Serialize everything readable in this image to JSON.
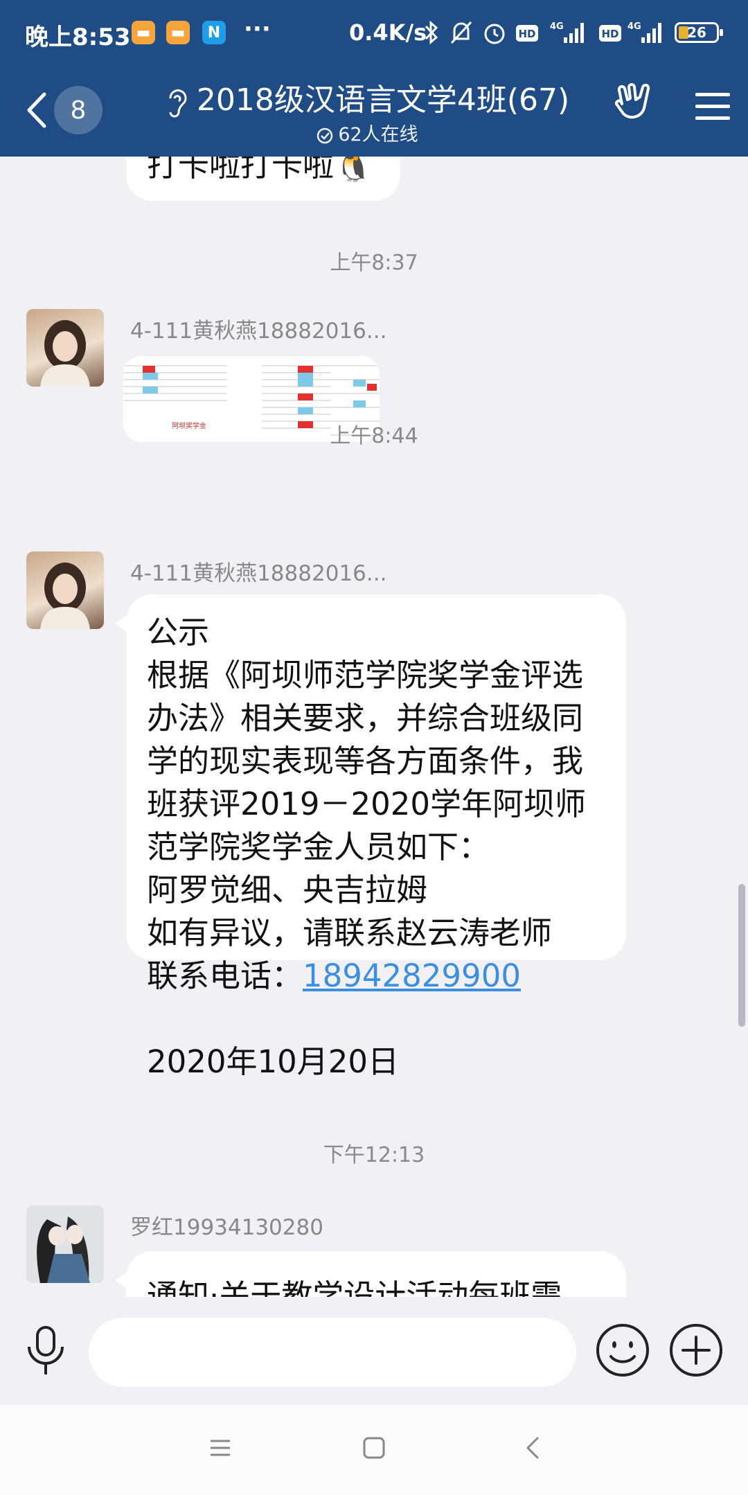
{
  "status_bar": {
    "time": "晚上8:53",
    "speed": "0.4K/s",
    "battery": "26",
    "more": "···"
  },
  "nav": {
    "back_count": "8",
    "title": "2018级汉语言文学4班(67)",
    "online": "62人在线"
  },
  "chat": {
    "partial_message": "打卡啦打卡啦",
    "timestamps": [
      "上午8:37",
      "上午8:44",
      "下午12:13"
    ],
    "messages": [
      {
        "sender": "4-111黄秋燕18882016...",
        "type": "image"
      },
      {
        "sender": "4-111黄秋燕18882016...",
        "type": "text",
        "text_before_link": "公示\n根据《阿坝师范学院奖学金评选办法》相关要求，并综合班级同学的现实表现等各方面条件，我班获评2019－2020学年阿坝师范学院奖学金人员如下：\n阿罗觉细、央吉拉姆\n如有异议，请联系赵云涛老师\n联系电话：",
        "link": "18942829900",
        "text_after_link": "\n\n2020年10月20日"
      },
      {
        "sender": "罗红19934130280",
        "type": "text",
        "text": "通知·关于教学设计活动每班需"
      }
    ],
    "image_text": "阿坝奖学金"
  },
  "input": {
    "placeholder": ""
  },
  "icons": {
    "accent": "#1f4c84",
    "link_color": "#3b8ee0"
  }
}
